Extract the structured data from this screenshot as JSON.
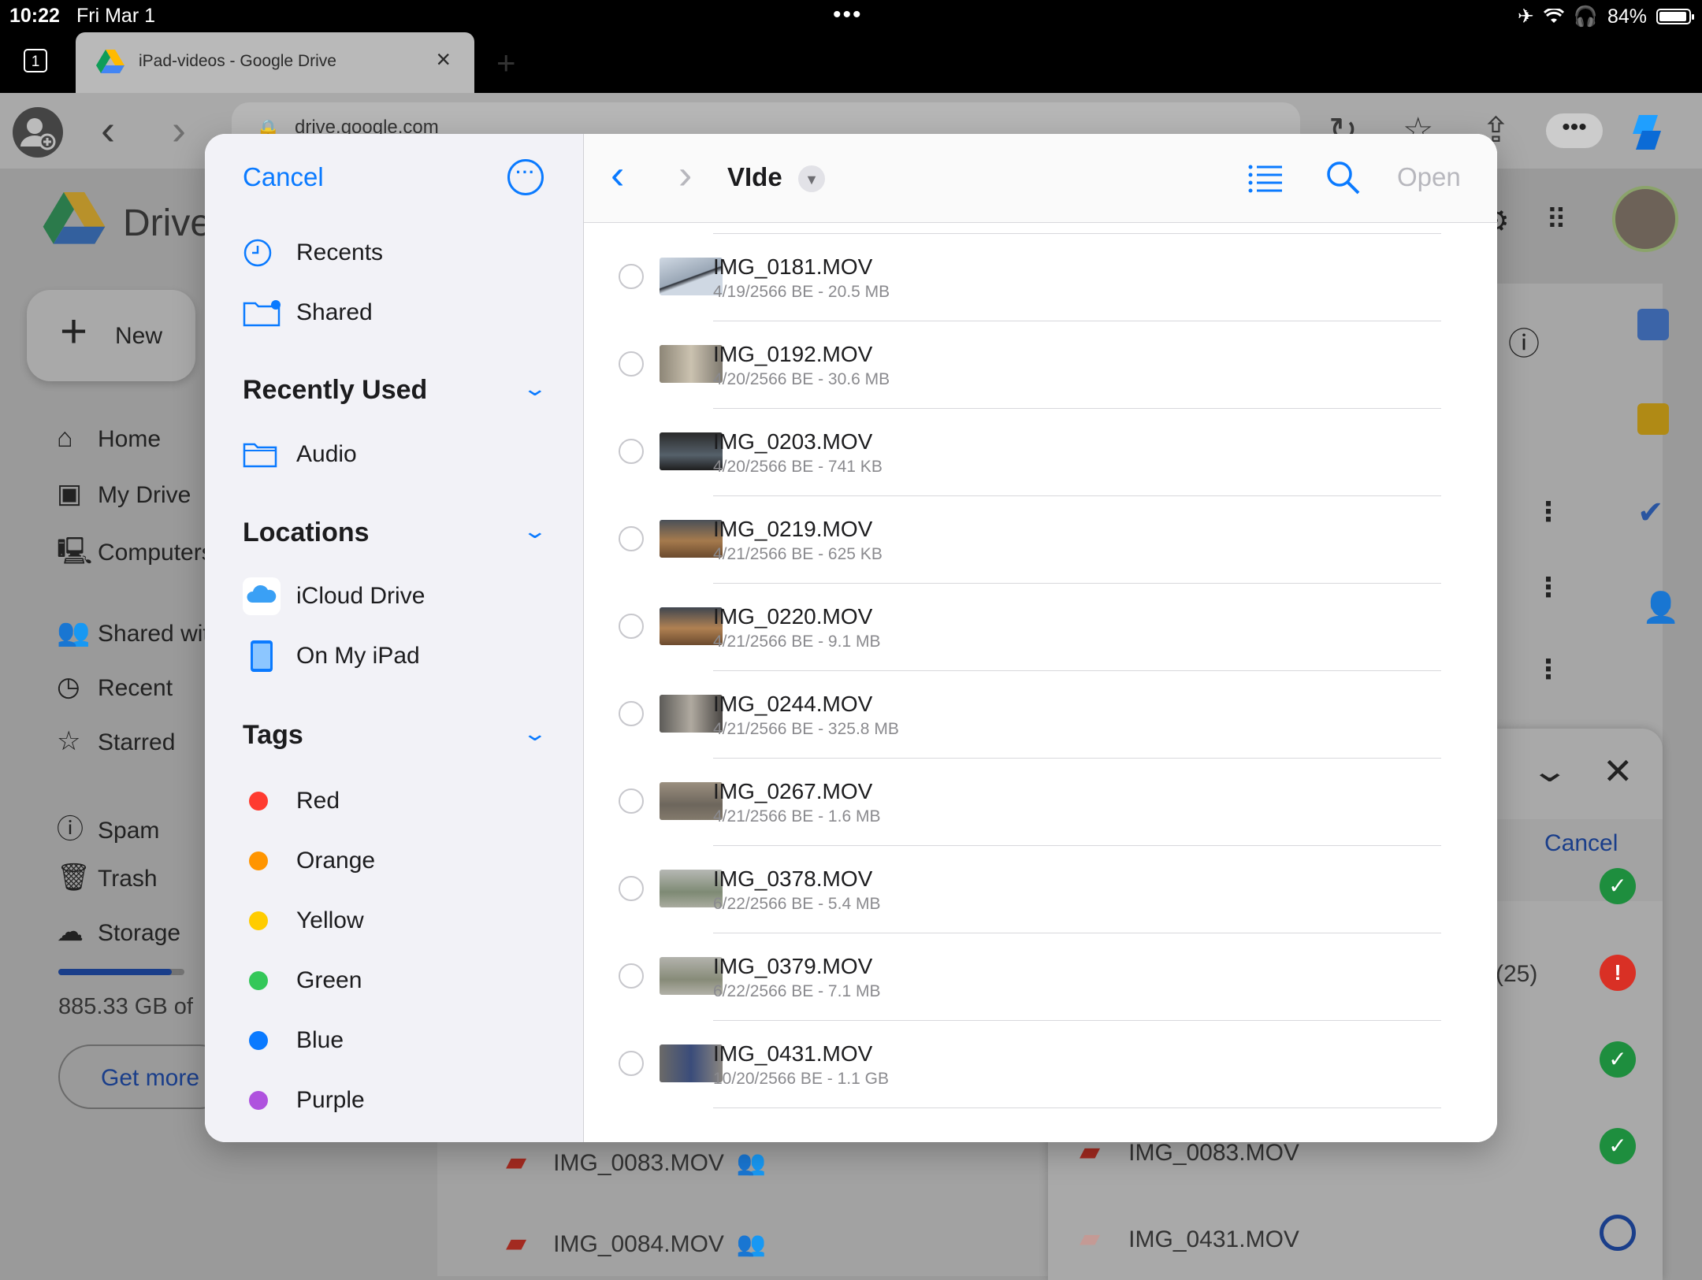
{
  "status_bar": {
    "time": "10:22",
    "date": "Fri Mar 1",
    "battery": "84%"
  },
  "browser": {
    "tab_count": "1",
    "tab_title": "iPad-videos - Google Drive",
    "url": "drive.google.com"
  },
  "drive": {
    "app_name": "Drive",
    "new_label": "New",
    "nav": [
      {
        "label": "Home",
        "icon": "home-icon"
      },
      {
        "label": "My Drive",
        "icon": "my-drive-icon"
      },
      {
        "label": "Computers",
        "icon": "computer-icon"
      },
      {
        "label": "Shared with me",
        "icon": "shared-people-icon"
      },
      {
        "label": "Recent",
        "icon": "clock-icon"
      },
      {
        "label": "Starred",
        "icon": "star-icon"
      },
      {
        "label": "Spam",
        "icon": "spam-icon"
      },
      {
        "label": "Trash",
        "icon": "trash-icon"
      },
      {
        "label": "Storage",
        "icon": "cloud-icon"
      }
    ],
    "storage_text": "885.33 GB of",
    "storage_fraction": 0.9,
    "get_more_label": "Get more",
    "background_files": [
      "IMG_0083.MOV",
      "IMG_0084.MOV"
    ],
    "upload_panel": {
      "cancel_label": "Cancel",
      "count_text": "(25)",
      "files": [
        "IMG_0083.MOV",
        "IMG_0431.MOV"
      ]
    }
  },
  "picker": {
    "cancel_label": "Cancel",
    "quick": [
      {
        "label": "Recents",
        "icon": "clock-icon"
      },
      {
        "label": "Shared",
        "icon": "shared-folder-icon"
      }
    ],
    "recently_used": {
      "title": "Recently Used",
      "items": [
        {
          "label": "Audio",
          "icon": "folder-icon"
        }
      ]
    },
    "locations": {
      "title": "Locations",
      "items": [
        {
          "label": "iCloud Drive",
          "icon": "icloud-icon"
        },
        {
          "label": "On My iPad",
          "icon": "ipad-icon"
        }
      ]
    },
    "tags": {
      "title": "Tags",
      "items": [
        {
          "label": "Red",
          "color": "#ff3b30"
        },
        {
          "label": "Orange",
          "color": "#ff9500"
        },
        {
          "label": "Yellow",
          "color": "#ffcc00"
        },
        {
          "label": "Green",
          "color": "#34c759"
        },
        {
          "label": "Blue",
          "color": "#0a7aff"
        },
        {
          "label": "Purple",
          "color": "#af52de"
        }
      ]
    },
    "folder_title": "VIde",
    "open_label": "Open",
    "files": [
      {
        "name": "IMG_0181.MOV",
        "meta": "4/19/2566 BE - 20.5 MB"
      },
      {
        "name": "IMG_0192.MOV",
        "meta": "4/20/2566 BE - 30.6 MB"
      },
      {
        "name": "IMG_0203.MOV",
        "meta": "4/20/2566 BE - 741 KB"
      },
      {
        "name": "IMG_0219.MOV",
        "meta": "4/21/2566 BE - 625 KB"
      },
      {
        "name": "IMG_0220.MOV",
        "meta": "4/21/2566 BE - 9.1 MB"
      },
      {
        "name": "IMG_0244.MOV",
        "meta": "4/21/2566 BE - 325.8 MB"
      },
      {
        "name": "IMG_0267.MOV",
        "meta": "4/21/2566 BE - 1.6 MB"
      },
      {
        "name": "IMG_0378.MOV",
        "meta": "6/22/2566 BE - 5.4 MB"
      },
      {
        "name": "IMG_0379.MOV",
        "meta": "6/22/2566 BE - 7.1 MB"
      },
      {
        "name": "IMG_0431.MOV",
        "meta": "10/20/2566 BE - 1.1 GB"
      }
    ]
  },
  "colors": {
    "accent": "#0a7aff",
    "drive_blue": "#1a3e8a",
    "success": "#1e8e3e",
    "error": "#d93025"
  }
}
